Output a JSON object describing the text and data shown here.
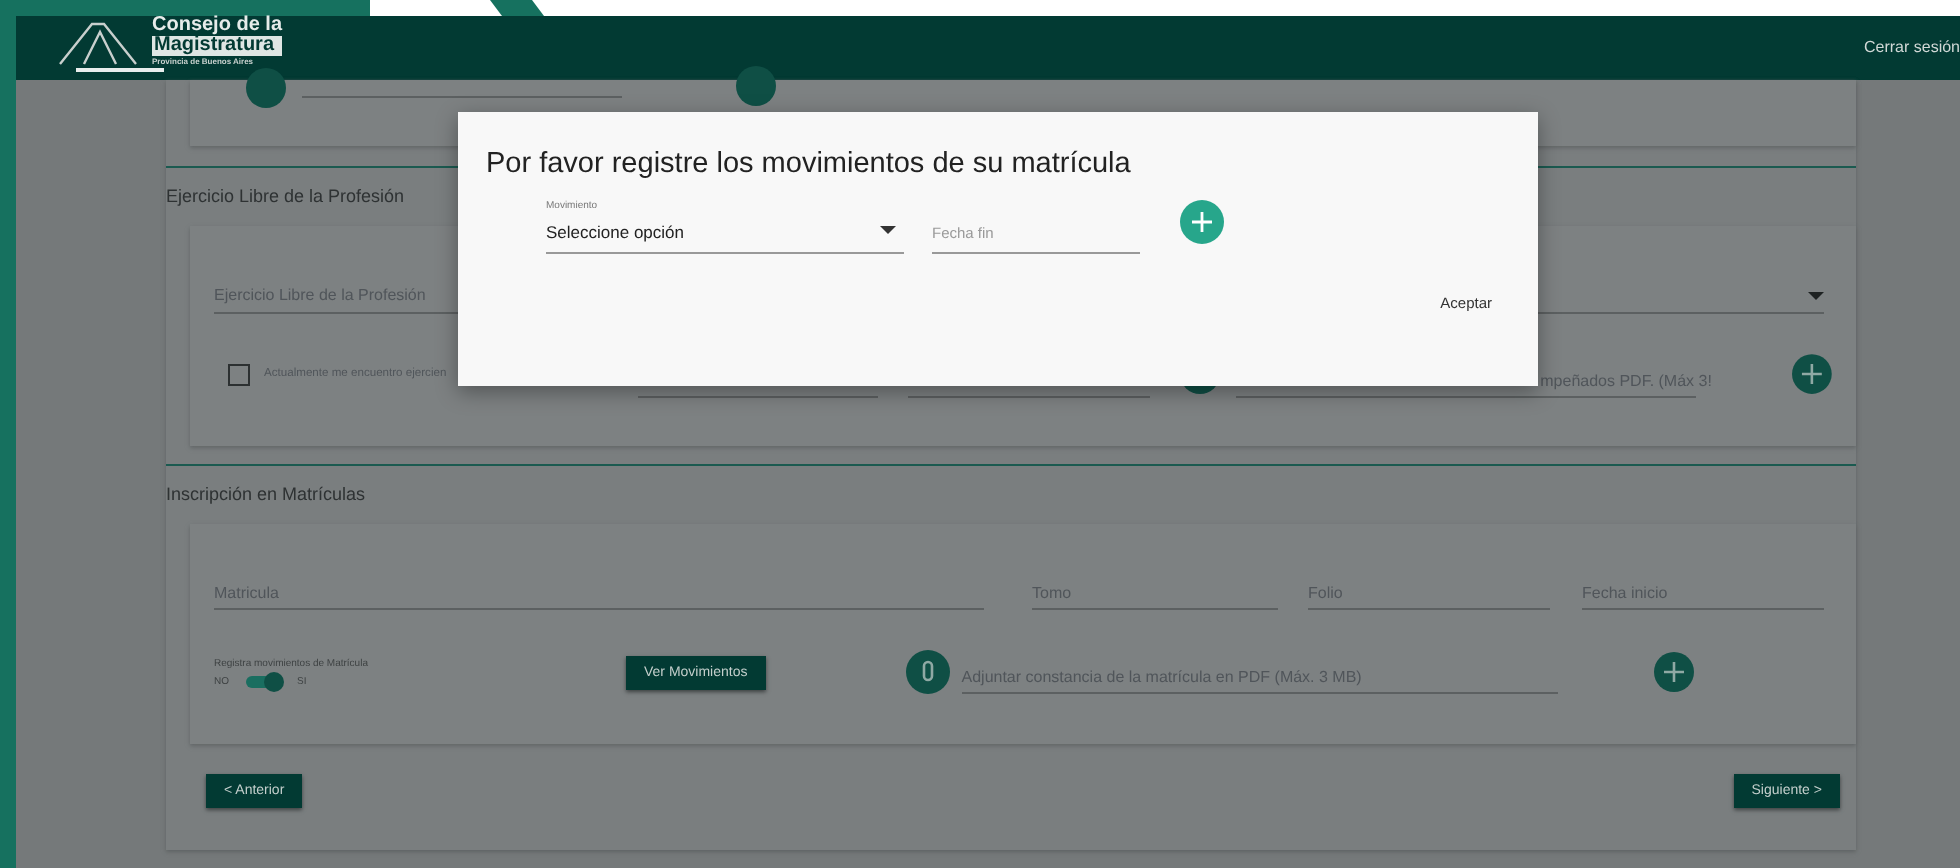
{
  "header": {
    "logo": {
      "line1": "Consejo de la",
      "line2": "Magistratura",
      "subtitle": "Provincia de Buenos Aires"
    },
    "logout": "Cerrar sesión"
  },
  "ejercicio": {
    "title": "Ejercicio Libre de la Profesión",
    "select": {
      "placeholder": "Ejercicio Libre de la Profesión"
    },
    "checkbox": {
      "label": "Actualmente me encuentro ejercien",
      "checked": false
    },
    "upload": {
      "placeholder": "mpeñados PDF. (Máx 3!"
    }
  },
  "inscripcion": {
    "title": "Inscripción en Matrículas",
    "fields": [
      {
        "placeholder": "Matricula"
      },
      {
        "placeholder": "Tomo"
      },
      {
        "placeholder": "Folio"
      },
      {
        "placeholder": "Fecha inicio"
      }
    ],
    "toggle": {
      "label": "Registra movimientos de Matrícula",
      "off_label": "NO",
      "on_label": "SI",
      "on": true
    },
    "view_button": "Ver Movimientos",
    "upload": {
      "placeholder": "Adjuntar constancia de la matrícula en PDF (Máx. 3 MB)"
    }
  },
  "nav": {
    "prev": "< Anterior",
    "next": "Siguiente >"
  },
  "modal": {
    "title": "Por favor registre los movimientos de su matrícula",
    "select": {
      "label": "Movimiento",
      "value": "Seleccione opción"
    },
    "date": {
      "placeholder": "Fecha fin"
    },
    "accept": "Aceptar"
  }
}
